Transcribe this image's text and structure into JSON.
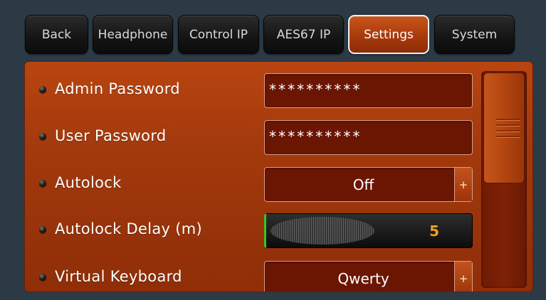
{
  "tabs": [
    {
      "label": "Back",
      "active": false
    },
    {
      "label": "Headphone",
      "active": false
    },
    {
      "label": "Control IP",
      "active": false
    },
    {
      "label": "AES67 IP",
      "active": false
    },
    {
      "label": "Settings",
      "active": true
    },
    {
      "label": "System",
      "active": false
    }
  ],
  "settings": {
    "admin_password": {
      "label": "Admin Password",
      "value": "**********"
    },
    "user_password": {
      "label": "User Password",
      "value": "**********"
    },
    "autolock": {
      "label": "Autolock",
      "value": "Off",
      "button": "+"
    },
    "autolock_delay": {
      "label": "Autolock Delay (m)",
      "value": "5"
    },
    "virtual_keyboard": {
      "label": "Virtual Keyboard",
      "value": "Qwerty",
      "button": "+"
    }
  },
  "colors": {
    "accent": "#a83a0c",
    "value_highlight": "#f0a020",
    "slider_edge": "#39c420"
  }
}
